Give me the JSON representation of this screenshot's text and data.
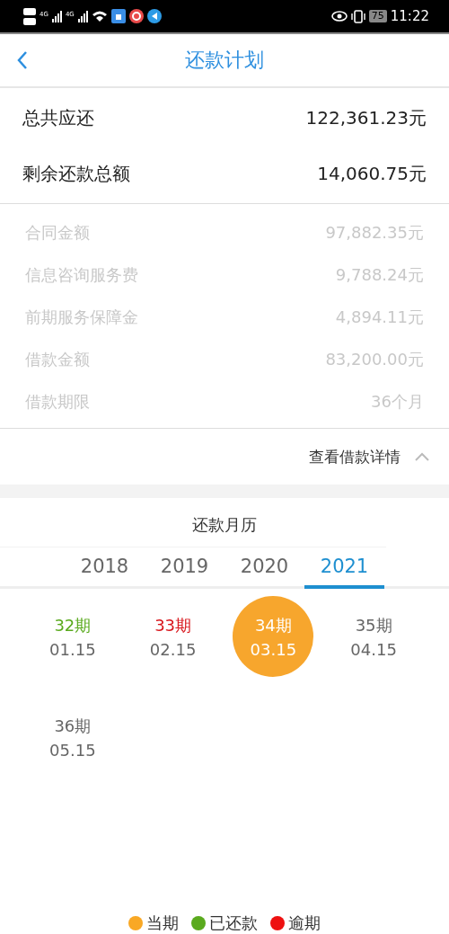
{
  "status_bar": {
    "network": [
      "4G",
      "4G"
    ],
    "battery": "75",
    "time": "11:22"
  },
  "header": {
    "title": "还款计划"
  },
  "summary": [
    {
      "label": "总共应还",
      "value": "122,361.23元"
    },
    {
      "label": "剩余还款总额",
      "value": "14,060.75元"
    }
  ],
  "details": [
    {
      "label": "合同金额",
      "value": "97,882.35元"
    },
    {
      "label": "信息咨询服务费",
      "value": "9,788.24元"
    },
    {
      "label": "前期服务保障金",
      "value": "4,894.11元"
    },
    {
      "label": "借款金额",
      "value": "83,200.00元"
    },
    {
      "label": "借款期限",
      "value": "36个月"
    }
  ],
  "details_toggle": {
    "label": "查看借款详情",
    "expanded": true
  },
  "calendar": {
    "title": "还款月历",
    "tabs": [
      {
        "label": "2018",
        "selected": false
      },
      {
        "label": "2019",
        "selected": false
      },
      {
        "label": "2020",
        "selected": false
      },
      {
        "label": "2021",
        "selected": true
      }
    ],
    "periods": [
      {
        "term": "32期",
        "date": "01.15",
        "color": "#5aaa1e",
        "selected": false
      },
      {
        "term": "33期",
        "date": "02.15",
        "color": "#d8151b",
        "selected": false
      },
      {
        "term": "34期",
        "date": "03.15",
        "color": "#f7a62d",
        "selected": true
      },
      {
        "term": "35期",
        "date": "04.15",
        "color": "#666666",
        "selected": false
      },
      {
        "term": "36期",
        "date": "05.15",
        "color": "#666666",
        "selected": false
      }
    ]
  },
  "legend": [
    {
      "label": "当期",
      "color": "#f9a825"
    },
    {
      "label": "已还款",
      "color": "#5aaa1e"
    },
    {
      "label": "逾期",
      "color": "#ee1111"
    }
  ]
}
